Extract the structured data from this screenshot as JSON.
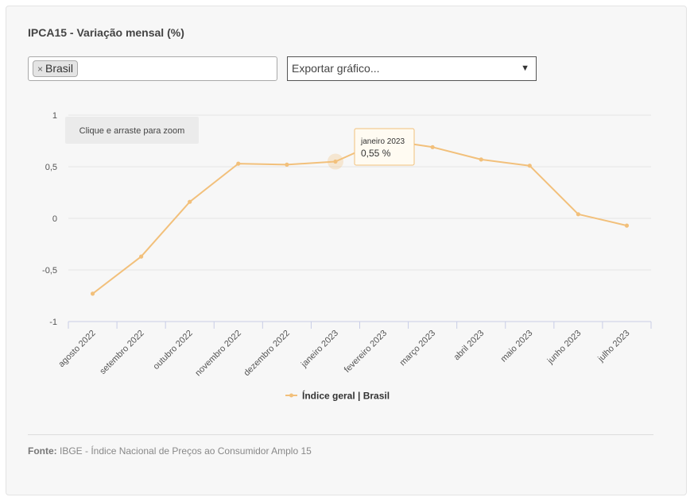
{
  "header": {
    "title": "IPCA15 - Variação mensal (%)"
  },
  "filter": {
    "remove_symbol": "×",
    "selected_tag": "Brasil"
  },
  "export": {
    "label": "Exportar gráfico..."
  },
  "zoom_hint": "Clique e arraste para zoom",
  "tooltip": {
    "date": "janeiro 2023",
    "value": "0,55 %"
  },
  "chart_data": {
    "type": "line",
    "categories": [
      "agosto 2022",
      "setembro 2022",
      "outubro 2022",
      "novembro 2022",
      "dezembro 2022",
      "janeiro 2023",
      "fevereiro 2023",
      "março 2023",
      "abril 2023",
      "maio 2023",
      "junho 2023",
      "julho 2023"
    ],
    "series": [
      {
        "name": "Índice geral | Brasil",
        "values": [
          -0.73,
          -0.37,
          0.16,
          0.53,
          0.52,
          0.55,
          0.76,
          0.69,
          0.57,
          0.51,
          0.04,
          -0.07
        ]
      }
    ],
    "ylim": [
      -1,
      1
    ],
    "yticks": [
      1,
      0.5,
      0,
      -0.5,
      -1
    ],
    "ytick_labels": [
      "1",
      "0,5",
      "0",
      "-0,5",
      "-1"
    ],
    "grid": true,
    "legend": "bottom-center",
    "color": "#f2c07b",
    "highlight_index": 5
  },
  "footer": {
    "label": "Fonte:",
    "source": "IBGE - Índice Nacional de Preços ao Consumidor Amplo 15"
  }
}
